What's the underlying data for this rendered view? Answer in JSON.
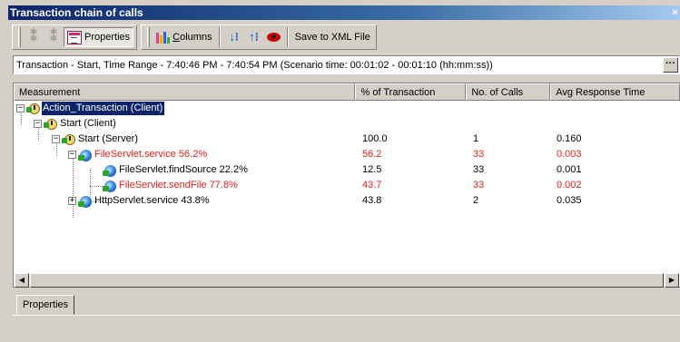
{
  "window": {
    "title": "Transaction chain of calls",
    "close_glyph": "×"
  },
  "toolbar": {
    "properties_label": "Properties",
    "columns_label": "Columns",
    "columns_underline": "C",
    "columns_rest": "olumns",
    "save_label": "Save to XML File"
  },
  "infobar": {
    "text": "Transaction - Start, Time Range - 7:40:46 PM - 7:40:54 PM (Scenario time: 00:01:02 - 00:01:10 (hh:mm:ss))",
    "more_label": "···"
  },
  "grid": {
    "columns": [
      "Measurement",
      "% of Transaction",
      "No. of Calls",
      "Avg Response Time"
    ],
    "rows": [
      {
        "label": "Action_Transaction (Client)",
        "pct": "",
        "calls": "",
        "avg": "",
        "icon": "clock-icon",
        "expander": "−",
        "selected": true,
        "red": false
      },
      {
        "label": "Start (Client)",
        "pct": "",
        "calls": "",
        "avg": "",
        "icon": "clock-icon",
        "expander": "−",
        "selected": false,
        "red": false
      },
      {
        "label": "Start (Server)",
        "pct": "100.0",
        "calls": "1",
        "avg": "0.160",
        "icon": "clock-icon",
        "expander": "−",
        "selected": false,
        "red": false
      },
      {
        "label": "FileServlet.service  56.2%",
        "pct": "56.2",
        "calls": "33",
        "avg": "0.003",
        "icon": "globe-icon",
        "expander": "−",
        "selected": false,
        "red": true
      },
      {
        "label": "FileServlet.findSource  22.2%",
        "pct": "12.5",
        "calls": "33",
        "avg": "0.001",
        "icon": "globe-icon",
        "expander": "",
        "selected": false,
        "red": false
      },
      {
        "label": "FileServlet.sendFile  77.8%",
        "pct": "43.7",
        "calls": "33",
        "avg": "0.002",
        "icon": "globe-icon",
        "expander": "",
        "selected": false,
        "red": true
      },
      {
        "label": "HttpServlet.service  43.8%",
        "pct": "43.8",
        "calls": "2",
        "avg": "0.035",
        "icon": "globe-icon",
        "expander": "+",
        "selected": false,
        "red": false
      }
    ]
  },
  "bottom": {
    "tab_label": "Properties"
  },
  "colors": {
    "title_bar": "#0a246a",
    "selection": "#0a246a",
    "critical_text": "#e8201c",
    "chrome": "#d4d0c8"
  }
}
